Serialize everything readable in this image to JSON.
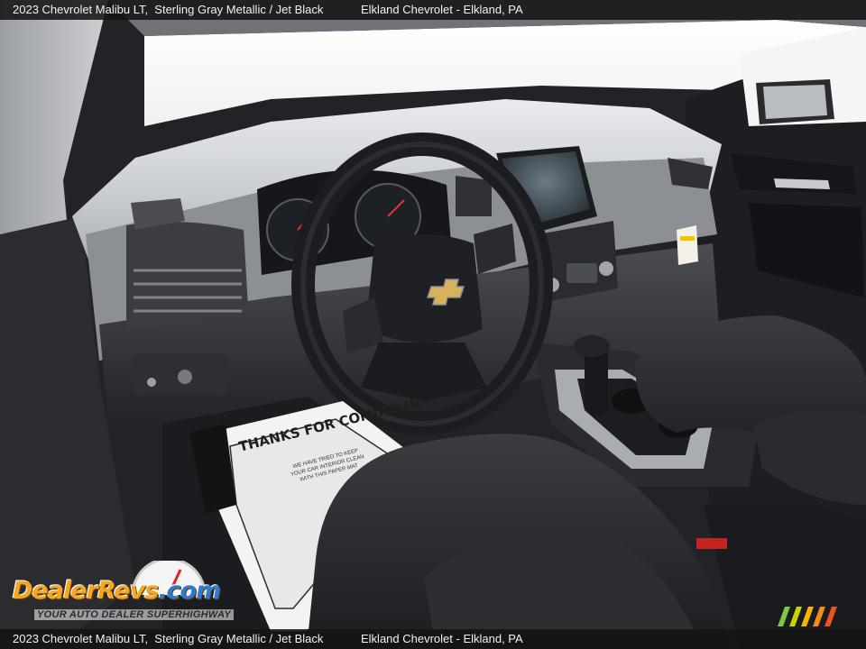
{
  "caption": {
    "model_text": "2023 Chevrolet Malibu LT,  Sterling Gray Metallic / Jet Black",
    "dealer_text": "Elkland Chevrolet - Elkland, PA"
  },
  "photo": {
    "mat_heading": "THANKS FOR COMING IN",
    "mat_text": "WE HAVE TRIED TO KEEP YOUR CAR INTERIOR CLEAN WITH THIS PAPER MAT"
  },
  "watermark": {
    "brand_part1": "DealerRevs",
    "brand_part2": ".com",
    "tagline": "YOUR AUTO DEALER SUPERHIGHWAY",
    "colors": {
      "brand": "#f5a623",
      "brand_accent": "#2e7bd6"
    }
  }
}
